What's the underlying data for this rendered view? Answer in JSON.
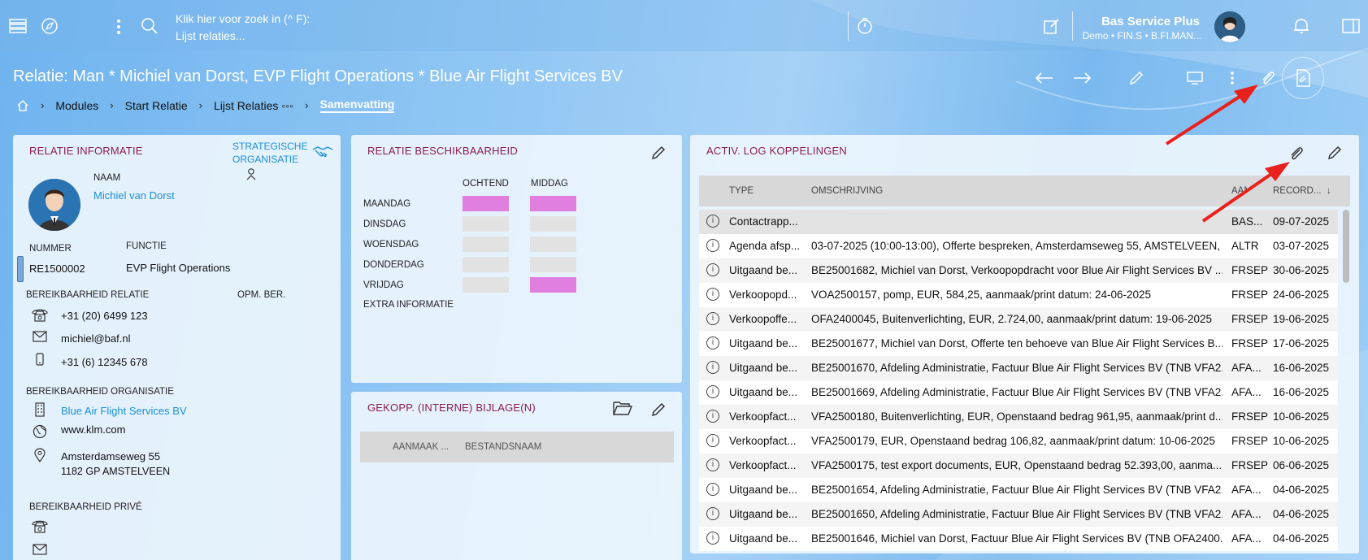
{
  "topbar": {
    "search_line1": "Klik hier voor zoek in (^ F):",
    "search_line2": "Lijst relaties...",
    "user_name": "Bas Service Plus",
    "user_sub": "Demo • FIN.S • B.FI.MAN...",
    "icons": [
      "menu-icon",
      "compass-icon",
      "more-vert-icon",
      "search-icon",
      "timer-icon",
      "edit-note-icon",
      "avatar",
      "bell-icon",
      "panel-icon"
    ]
  },
  "page": {
    "title": "Relatie: Man * Michiel van Dorst, EVP Flight Operations * Blue Air Flight Services BV",
    "breadcrumb": [
      "Modules",
      "Start Relatie",
      "Lijst Relaties ◦◦◦",
      "Samenvatting"
    ]
  },
  "relatie": {
    "title": "RELATIE INFORMATIE",
    "org_label_1": "STRATEGISCHE",
    "org_label_2": "ORGANISATIE",
    "naam_label": "NAAM",
    "naam": "Michiel van Dorst",
    "nummer_label": "NUMMER",
    "nummer": "RE1500002",
    "functie_label": "FUNCTIE",
    "functie": "EVP Flight Operations",
    "bereik_relatie_label": "BEREIKBAARHEID RELATIE",
    "opm_label": "OPM. BER.",
    "phone": "+31 (20) 6499 123",
    "email": "michiel@baf.nl",
    "mobile": "+31 (6) 12345 678",
    "bereik_org_label": "BEREIKBAARHEID ORGANISATIE",
    "org_name": "Blue Air Flight Services BV",
    "website": "www.klm.com",
    "address1": "Amsterdamseweg 55",
    "address2": "1182 GP  AMSTELVEEN",
    "bereik_prive_label": "BEREIKBAARHEID PRIVÉ"
  },
  "beschikbaarheid": {
    "title": "RELATIE BESCHIKBAARHEID",
    "col_ochtend": "OCHTEND",
    "col_middag": "MIDDAG",
    "days": [
      {
        "day": "MAANDAG",
        "ochtend": true,
        "middag": true
      },
      {
        "day": "DINSDAG",
        "ochtend": false,
        "middag": false
      },
      {
        "day": "WOENSDAG",
        "ochtend": false,
        "middag": false
      },
      {
        "day": "DONDERDAG",
        "ochtend": false,
        "middag": false
      },
      {
        "day": "VRIJDAG",
        "ochtend": false,
        "middag": true
      }
    ],
    "extra": "EXTRA INFORMATIE",
    "highlight_color": "#e07fe0"
  },
  "bijlagen": {
    "title": "GEKOPP. (INTERNE) BIJLAGE(N)",
    "col1": "AANMAAK ...",
    "col2": "BESTANDSNAAM"
  },
  "activlog": {
    "title": "ACTIV. LOG KOPPELINGEN",
    "columns": {
      "type": "TYPE",
      "omschrijving": "OMSCHRIJVING",
      "aan": "AAN",
      "record": "RECORD...",
      "sort": "↓"
    },
    "rows": [
      {
        "type": "Contactrapp...",
        "desc": "",
        "aan": "BAS...",
        "date": "09-07-2025"
      },
      {
        "type": "Agenda afsp...",
        "desc": "03-07-2025 (10:00-13:00), Offerte bespreken, Amsterdamseweg 55, AMSTELVEEN, ...",
        "aan": "ALTR",
        "date": "03-07-2025"
      },
      {
        "type": "Uitgaand be...",
        "desc": "BE25001682, Michiel van Dorst, Verkoopopdracht voor Blue Air Flight Services BV ...",
        "aan": "FRSEP",
        "date": "30-06-2025"
      },
      {
        "type": "Verkoopopd...",
        "desc": "VOA2500157, pomp, EUR, 584,25, aanmaak/print datum: 24-06-2025",
        "aan": "FRSEP",
        "date": "24-06-2025"
      },
      {
        "type": "Verkoopoffe...",
        "desc": "OFA2400045, Buitenverlichting, EUR, 2.724,00, aanmaak/print datum: 19-06-2025",
        "aan": "FRSEP",
        "date": "19-06-2025"
      },
      {
        "type": "Uitgaand be...",
        "desc": "BE25001677, Michiel van Dorst, Offerte ten behoeve van Blue Air Flight Services B...",
        "aan": "FRSEP",
        "date": "17-06-2025"
      },
      {
        "type": "Uitgaand be...",
        "desc": "BE25001670, Afdeling Administratie, Factuur Blue Air Flight Services BV (TNB VFA2...",
        "aan": "AFA...",
        "date": "16-06-2025"
      },
      {
        "type": "Uitgaand be...",
        "desc": "BE25001669, Afdeling Administratie, Factuur Blue Air Flight Services BV (TNB VFA2...",
        "aan": "AFA...",
        "date": "16-06-2025"
      },
      {
        "type": "Verkoopfact...",
        "desc": "VFA2500180, Buitenverlichting, EUR, Openstaand bedrag 961,95, aanmaak/print d...",
        "aan": "FRSEP",
        "date": "10-06-2025"
      },
      {
        "type": "Verkoopfact...",
        "desc": "VFA2500179, EUR, Openstaand bedrag 106,82, aanmaak/print datum: 10-06-2025",
        "aan": "FRSEP",
        "date": "10-06-2025"
      },
      {
        "type": "Verkoopfact...",
        "desc": "VFA2500175, test export documents, EUR, Openstaand bedrag 52.393,00, aanma...",
        "aan": "FRSEP",
        "date": "06-06-2025"
      },
      {
        "type": "Uitgaand be...",
        "desc": "BE25001654, Afdeling Administratie, Factuur Blue Air Flight Services BV (TNB VFA2...",
        "aan": "AFA...",
        "date": "04-06-2025"
      },
      {
        "type": "Uitgaand be...",
        "desc": "BE25001650, Afdeling Administratie, Factuur Blue Air Flight Services BV (TNB VFA2...",
        "aan": "AFA...",
        "date": "04-06-2025"
      },
      {
        "type": "Uitgaand be...",
        "desc": "BE25001646, Michiel van Dorst, Factuur Blue Air Flight Services BV (TNB OFA2400...",
        "aan": "AFA...",
        "date": "04-06-2025"
      }
    ]
  },
  "annotation_color": "#e8211d"
}
